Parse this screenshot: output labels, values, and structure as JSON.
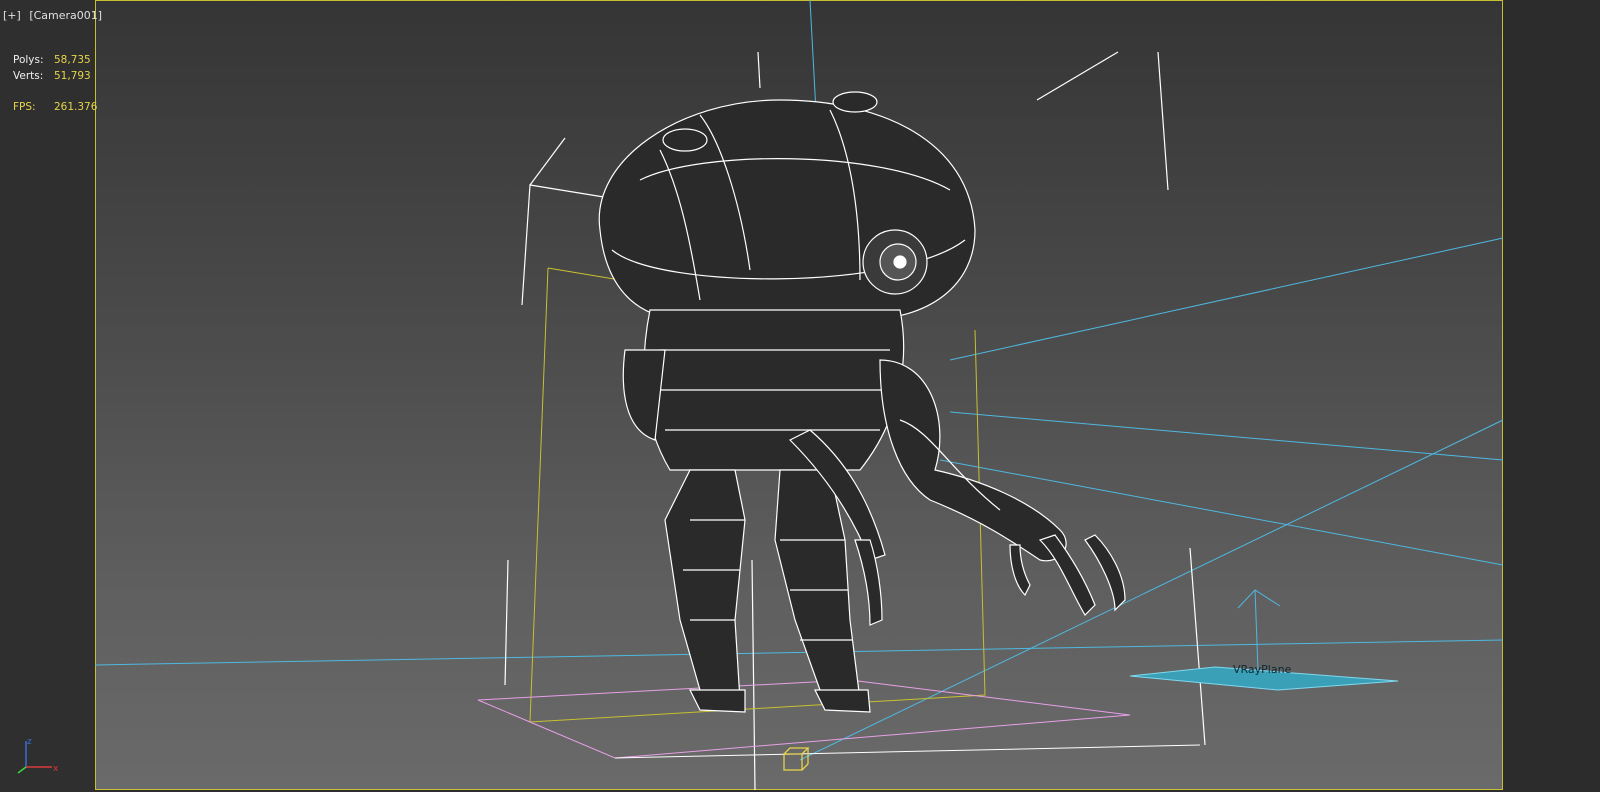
{
  "viewport": {
    "menu_plus": "[+]",
    "camera_name": "[Camera001]"
  },
  "stats": {
    "polys_label": "Polys:",
    "polys_value": "58,735",
    "verts_label": "Verts:",
    "verts_value": "51,793",
    "fps_label": "FPS:",
    "fps_value": "261.376"
  },
  "scene": {
    "object_label": "VRayPlane",
    "wireframe_color": "#ffffff",
    "camera_line_color": "#4fb8e0",
    "selection_box_color": "#c8c030",
    "grid_plane_color": "#e8a0e8"
  },
  "axis": {
    "x_label": "x",
    "z_label": "z"
  }
}
